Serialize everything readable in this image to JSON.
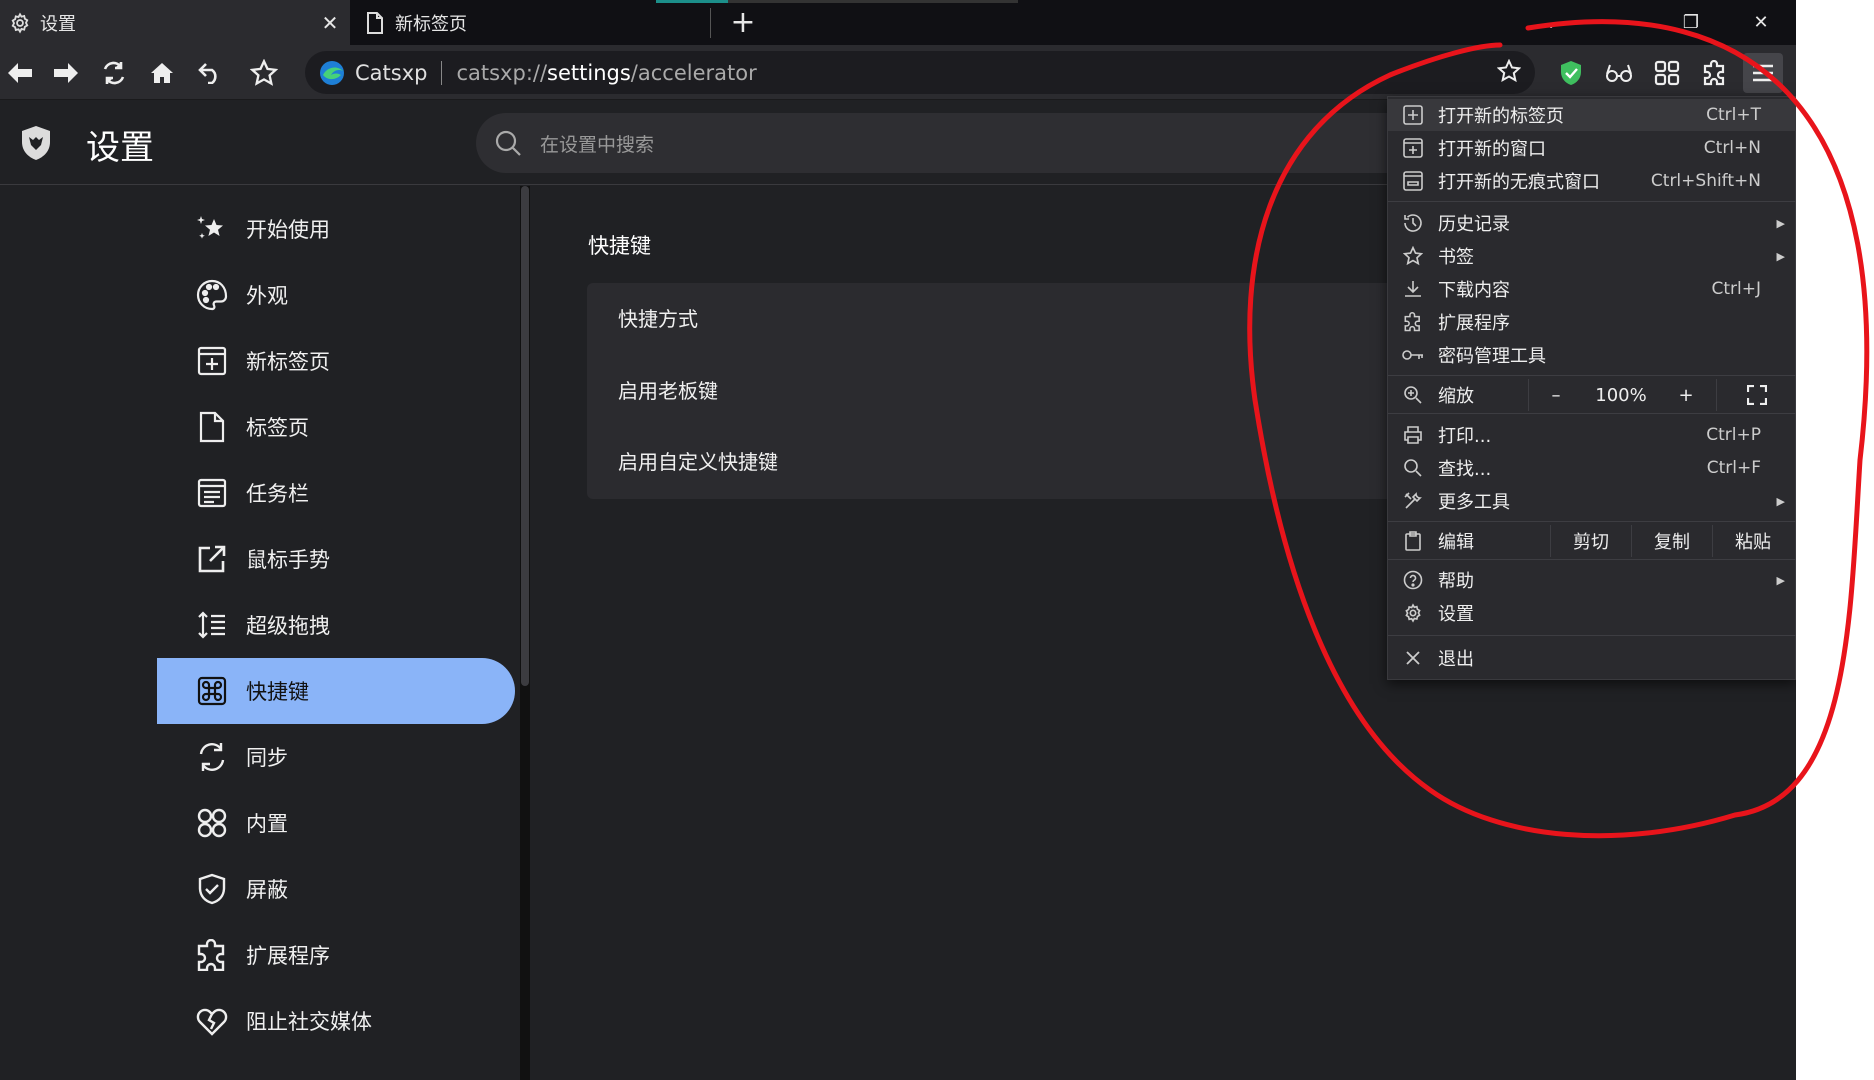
{
  "tabs": [
    {
      "label": "设置",
      "icon": "gear-icon",
      "close": "✕"
    },
    {
      "label": "新标签页",
      "icon": "page-icon"
    }
  ],
  "newtab_symbol": "+",
  "window_controls": {
    "dropdown": "⌄",
    "minimize": "—",
    "restore": "❐",
    "close": "✕"
  },
  "omnibox": {
    "site_name": "Catsxp",
    "url_prefix": "catsxp://",
    "url_bold": "settings",
    "url_suffix": "/accelerator"
  },
  "settings": {
    "title": "设置",
    "search_placeholder": "在设置中搜索"
  },
  "sidebar": {
    "items": [
      {
        "label": "开始使用",
        "icon": "sparkle-icon"
      },
      {
        "label": "外观",
        "icon": "palette-icon"
      },
      {
        "label": "新标签页",
        "icon": "new-tab-icon"
      },
      {
        "label": "标签页",
        "icon": "page-icon"
      },
      {
        "label": "任务栏",
        "icon": "taskbar-icon"
      },
      {
        "label": "鼠标手势",
        "icon": "external-link-icon"
      },
      {
        "label": "超级拖拽",
        "icon": "sort-icon"
      },
      {
        "label": "快捷键",
        "icon": "command-icon",
        "active": true
      },
      {
        "label": "同步",
        "icon": "sync-icon"
      },
      {
        "label": "内置",
        "icon": "command-grid-icon"
      },
      {
        "label": "屏蔽",
        "icon": "shield-icon"
      },
      {
        "label": "扩展程序",
        "icon": "puzzle-icon"
      },
      {
        "label": "阻止社交媒体",
        "icon": "heart-broken-icon"
      }
    ]
  },
  "main": {
    "section_title": "快捷键",
    "rows": [
      "快捷方式",
      "启用老板键",
      "启用自定义快捷键"
    ]
  },
  "menu": {
    "items": [
      {
        "label": "打开新的标签页",
        "shortcut": "Ctrl+T",
        "icon": "new-tab-icon"
      },
      {
        "label": "打开新的窗口",
        "shortcut": "Ctrl+N",
        "icon": "new-window-icon"
      },
      {
        "label": "打开新的无痕式窗口",
        "shortcut": "Ctrl+Shift+N",
        "icon": "incognito-window-icon"
      },
      {
        "label": "历史记录",
        "arrow": "▶",
        "icon": "history-icon"
      },
      {
        "label": "书签",
        "arrow": "▶",
        "icon": "star-icon"
      },
      {
        "label": "下载内容",
        "shortcut": "Ctrl+J",
        "icon": "download-icon"
      },
      {
        "label": "扩展程序",
        "icon": "puzzle-icon"
      },
      {
        "label": "密码管理工具",
        "icon": "key-icon"
      },
      {
        "label": "缩放",
        "icon": "zoom-icon"
      },
      {
        "label": "打印...",
        "shortcut": "Ctrl+P",
        "icon": "print-icon"
      },
      {
        "label": "查找...",
        "shortcut": "Ctrl+F",
        "icon": "search-icon"
      },
      {
        "label": "更多工具",
        "arrow": "▶",
        "icon": "tools-icon"
      },
      {
        "label": "编辑",
        "icon": "clipboard-icon"
      },
      {
        "label": "帮助",
        "arrow": "▶",
        "icon": "help-icon"
      },
      {
        "label": "设置",
        "icon": "gear-icon"
      },
      {
        "label": "退出",
        "icon": "close-icon"
      }
    ],
    "zoom": {
      "minus": "–",
      "value": "100%",
      "plus": "+"
    },
    "edit": {
      "cut": "剪切",
      "copy": "复制",
      "paste": "粘贴"
    }
  },
  "colors": {
    "accent": "#8ab4f8",
    "annotation": "#e8141b",
    "shield": "#3fbf5f"
  }
}
